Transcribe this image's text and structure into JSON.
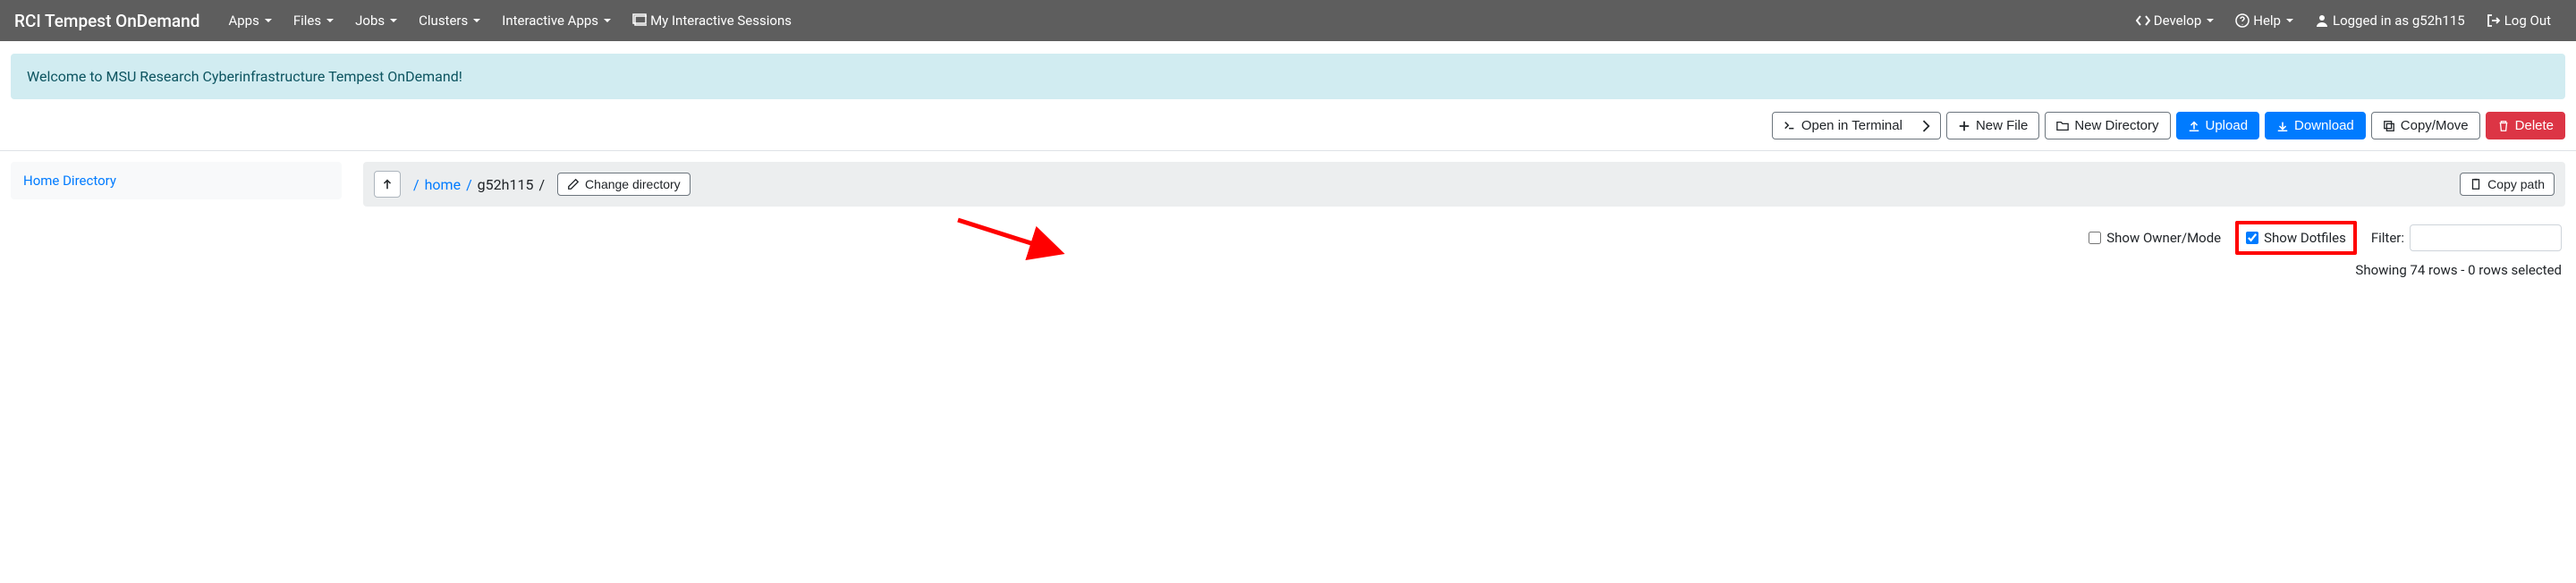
{
  "navbar": {
    "brand": "RCI Tempest OnDemand",
    "left": [
      {
        "label": "Apps",
        "dropdown": true
      },
      {
        "label": "Files",
        "dropdown": true
      },
      {
        "label": "Jobs",
        "dropdown": true
      },
      {
        "label": "Clusters",
        "dropdown": true
      },
      {
        "label": "Interactive Apps",
        "dropdown": true
      },
      {
        "label": "My Interactive Sessions",
        "icon": "windows-icon",
        "dropdown": false
      }
    ],
    "right": [
      {
        "label": "Develop",
        "icon": "code-icon",
        "dropdown": true
      },
      {
        "label": "Help",
        "icon": "help-icon",
        "dropdown": true
      },
      {
        "label": "Logged in as g52h115",
        "icon": "user-icon",
        "dropdown": false
      },
      {
        "label": "Log Out",
        "icon": "logout-icon",
        "dropdown": false
      }
    ]
  },
  "alert": {
    "text": "Welcome to MSU Research Cyberinfrastructure Tempest OnDemand!"
  },
  "toolbar": {
    "open_terminal": "Open in Terminal",
    "new_file": "New File",
    "new_directory": "New Directory",
    "upload": "Upload",
    "download": "Download",
    "copy_move": "Copy/Move",
    "delete": "Delete"
  },
  "sidebar": {
    "home": "Home Directory"
  },
  "breadcrumb": {
    "segments": [
      {
        "label": "home",
        "link": true
      },
      {
        "label": "g52h115",
        "link": false
      }
    ],
    "change_dir": "Change directory",
    "copy_path": "Copy path"
  },
  "controls": {
    "show_owner_mode": {
      "label": "Show Owner/Mode",
      "checked": false
    },
    "show_dotfiles": {
      "label": "Show Dotfiles",
      "checked": true
    },
    "filter_label": "Filter:",
    "filter_value": ""
  },
  "status": "Showing 74 rows - 0 rows selected"
}
